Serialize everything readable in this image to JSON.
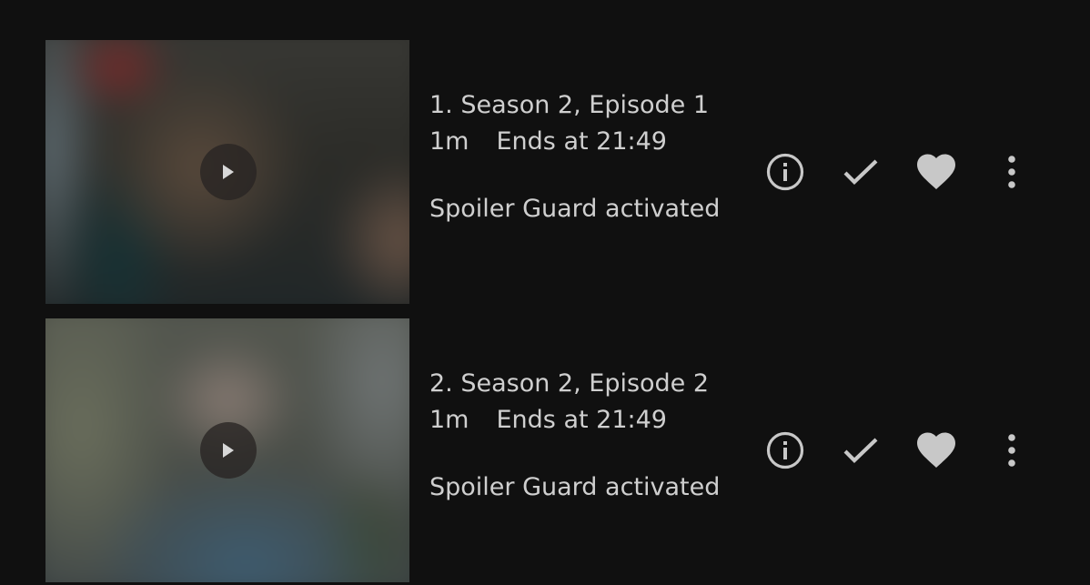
{
  "episodes": [
    {
      "title": "1. Season 2, Episode 1",
      "runtime": "1m",
      "ends_at": "Ends at 21:49",
      "overview": "Spoiler Guard activated"
    },
    {
      "title": "2. Season 2, Episode 2",
      "runtime": "1m",
      "ends_at": "Ends at 21:49",
      "overview": "Spoiler Guard activated"
    }
  ],
  "icons": {
    "play": "play-icon",
    "info": "info-icon",
    "played": "check-icon",
    "favorite": "heart-icon",
    "more": "more-vertical-icon"
  },
  "colors": {
    "background": "#101010",
    "text": "#cfcfcf",
    "icon": "#c8c8c8"
  }
}
